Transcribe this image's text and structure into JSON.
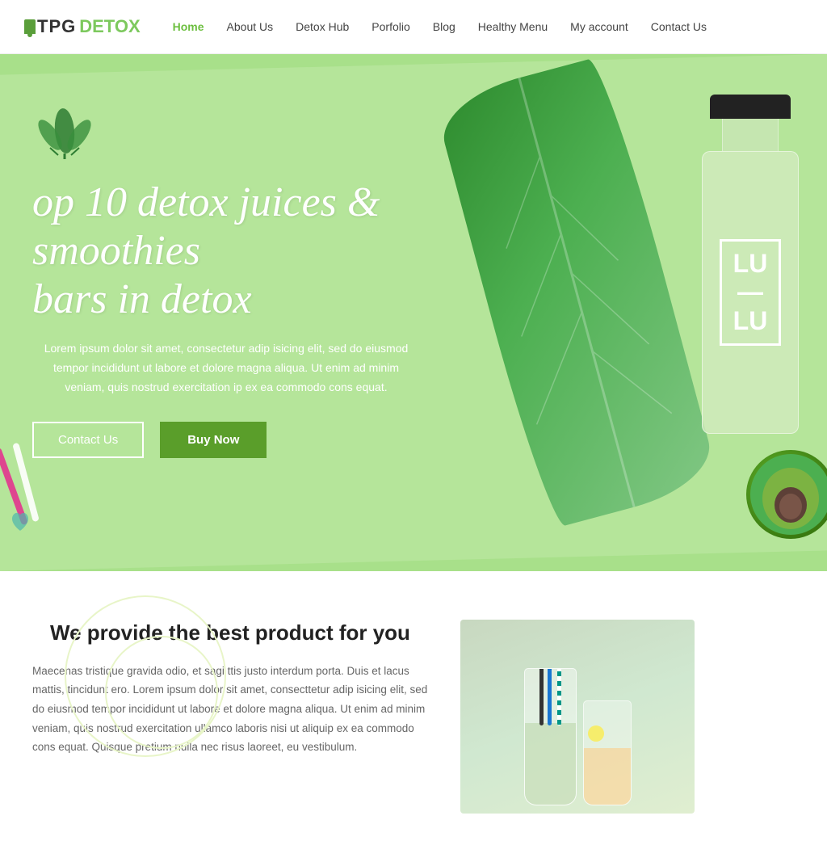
{
  "header": {
    "logo": {
      "tpg": "TPG",
      "detox": "DETOX"
    },
    "nav": [
      {
        "label": "Home",
        "active": true
      },
      {
        "label": "About Us",
        "active": false
      },
      {
        "label": "Detox Hub",
        "active": false
      },
      {
        "label": "Porfolio",
        "active": false
      },
      {
        "label": "Blog",
        "active": false
      },
      {
        "label": "Healthy Menu",
        "active": false
      },
      {
        "label": "My account",
        "active": false
      },
      {
        "label": "Contact Us",
        "active": false
      }
    ]
  },
  "hero": {
    "leaf_icon": "🌿",
    "title_line1": "op 10 detox juices & smoothies",
    "title_line2": "bars in detox",
    "description": "Lorem ipsum dolor sit amet, consectetur adip isicing elit, sed do eiusmod tempor incididunt ut labore et dolore magna aliqua. Ut enim ad minim veniam, quis nostrud exercitation ip ex ea commodo cons equat.",
    "btn_contact": "Contact Us",
    "btn_buy": "Buy Now",
    "bottle_label_line1": "LU",
    "bottle_label_line2": "—",
    "bottle_label_line3": "LU"
  },
  "section2": {
    "title": "We provide the best product for you",
    "description": "Maecenas tristique gravida odio, et sagi ttis justo interdum porta. Duis et lacus mattis, tincidunt ero. Lorem ipsum dolor sit amet, consecttetur adip isicing elit, sed do eiusmod tempor incididunt ut labore et dolore magna aliqua. Ut enim ad minim veniam, quis nostrud exercitation ullamco laboris nisi ut aliquip ex ea commodo cons equat. Quisque pretium nulla nec risus laoreet, eu vestibulum."
  },
  "colors": {
    "green_primary": "#6dbf40",
    "green_dark": "#5a9e2a",
    "green_hero": "#b5e59a",
    "white": "#ffffff"
  }
}
